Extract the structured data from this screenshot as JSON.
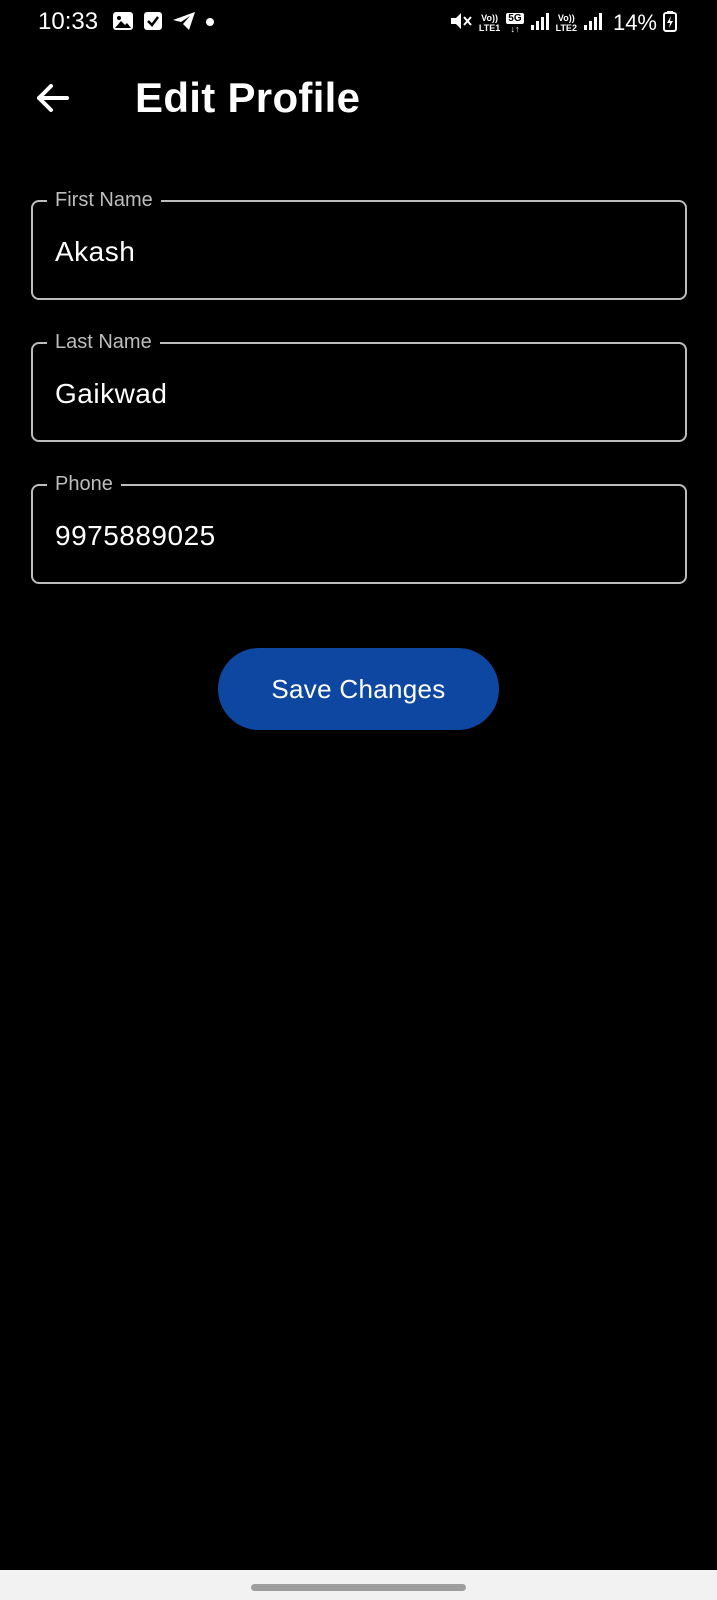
{
  "status_bar": {
    "time": "10:33",
    "net1_top": "Vo))",
    "net1_bottom": "LTE1",
    "fiveg": "5G",
    "net2_top": "Vo))",
    "net2_bottom": "LTE2",
    "battery": "14%",
    "icons": [
      "gallery-icon",
      "checkbox-icon",
      "telegram-icon",
      "dot-icon",
      "mute-icon",
      "signal-icon",
      "battery-charging-icon"
    ]
  },
  "app_bar": {
    "title": "Edit Profile",
    "back_icon": "arrow-left-icon"
  },
  "form": {
    "first_name": {
      "label": "First Name",
      "value": "Akash"
    },
    "last_name": {
      "label": "Last Name",
      "value": "Gaikwad"
    },
    "phone": {
      "label": "Phone",
      "value": "9975889025"
    },
    "save_label": "Save Changes"
  },
  "colors": {
    "background": "#000000",
    "accent": "#0d47a1",
    "field_border": "#bdbdbd",
    "nav_bar": "#f2f2f2"
  }
}
